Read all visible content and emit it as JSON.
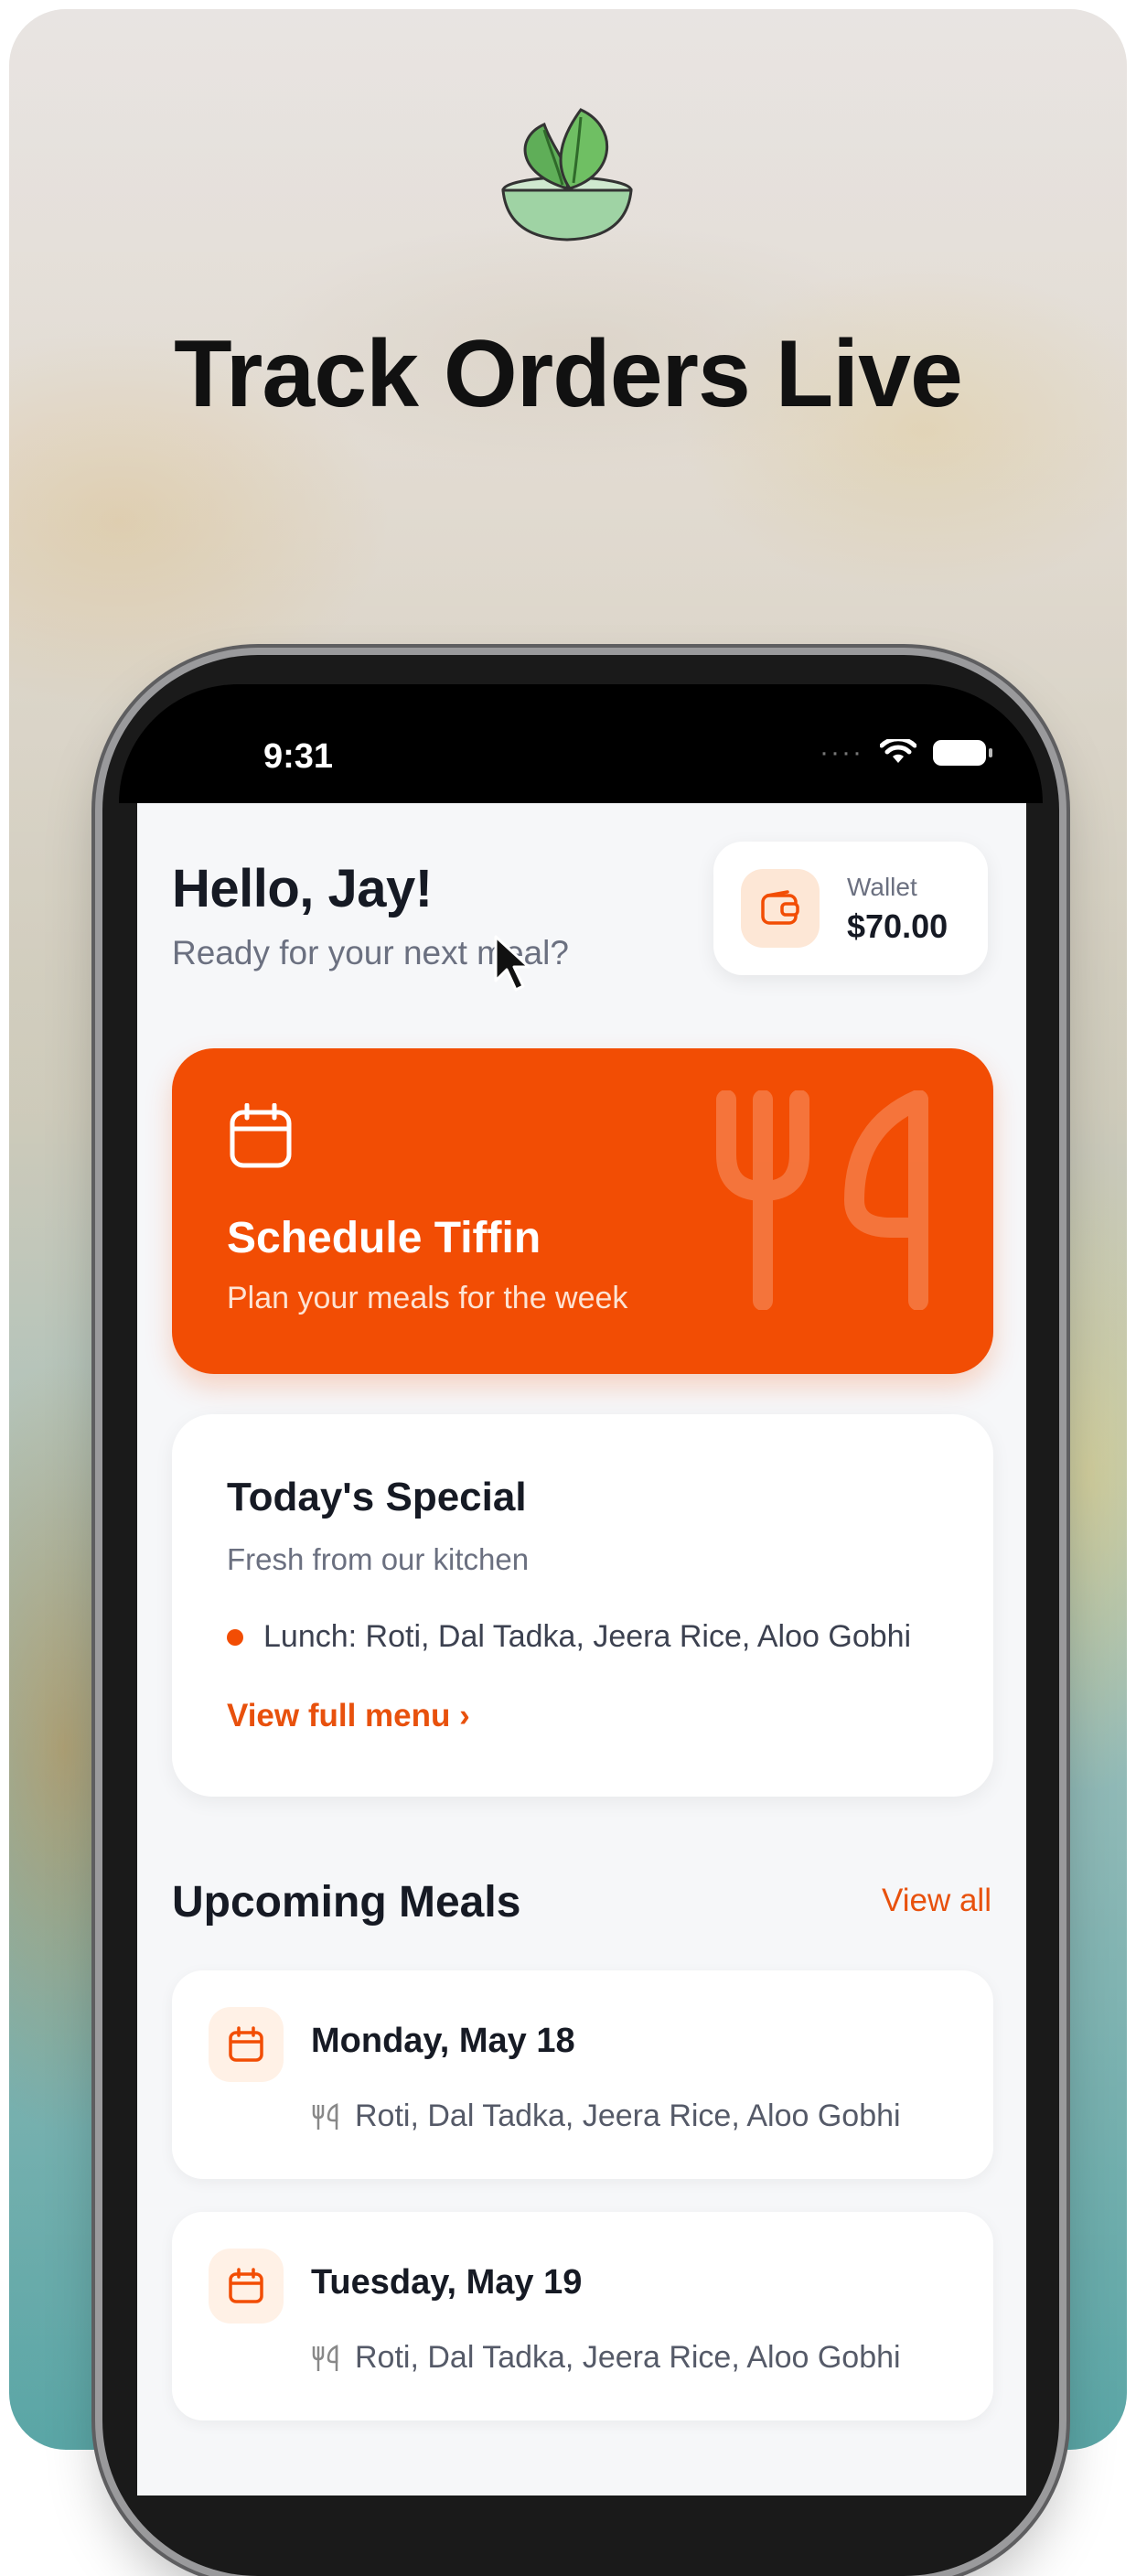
{
  "headline": "Track Orders Live",
  "status_bar": {
    "time": "9:31"
  },
  "greeting": {
    "title": "Hello, Jay!",
    "subtitle": "Ready for your next meal?"
  },
  "wallet": {
    "label": "Wallet",
    "amount": "$70.00"
  },
  "schedule_card": {
    "title": "Schedule Tiffin",
    "subtitle": "Plan your meals for the week"
  },
  "todays_special": {
    "title": "Today's Special",
    "subtitle": "Fresh from our kitchen",
    "item": "Lunch: Roti, Dal Tadka, Jeera Rice, Aloo Gobhi",
    "link": "View full menu ›"
  },
  "upcoming": {
    "title": "Upcoming Meals",
    "view_all": "View all",
    "meals": [
      {
        "date": "Monday, May 18",
        "items": "Roti, Dal Tadka, Jeera Rice, Aloo Gobhi"
      },
      {
        "date": "Tuesday, May 19",
        "items": "Roti, Dal Tadka, Jeera Rice, Aloo Gobhi"
      }
    ]
  },
  "colors": {
    "accent": "#f24d04",
    "accent_text": "#e8510d",
    "text_dark": "#161a24",
    "text_muted": "#6b7080",
    "screen_bg": "#f6f7f9"
  },
  "icons": [
    "leaf-bowl-logo",
    "wallet-icon",
    "calendar-icon",
    "cutlery-icon",
    "chevron-right-icon",
    "cursor-pointer"
  ]
}
